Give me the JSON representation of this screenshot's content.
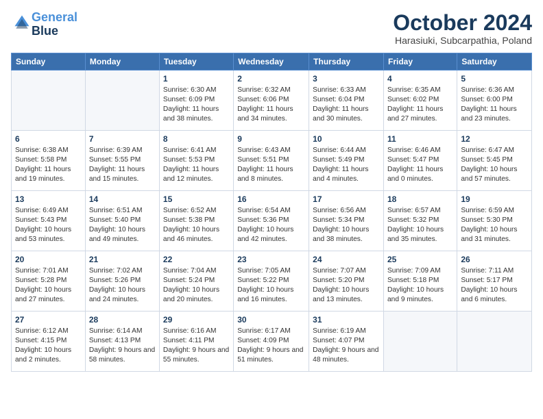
{
  "logo": {
    "line1": "General",
    "line2": "Blue"
  },
  "header": {
    "month": "October 2024",
    "location": "Harasiuki, Subcarpathia, Poland"
  },
  "weekdays": [
    "Sunday",
    "Monday",
    "Tuesday",
    "Wednesday",
    "Thursday",
    "Friday",
    "Saturday"
  ],
  "weeks": [
    [
      {
        "day": "",
        "info": ""
      },
      {
        "day": "",
        "info": ""
      },
      {
        "day": "1",
        "info": "Sunrise: 6:30 AM\nSunset: 6:09 PM\nDaylight: 11 hours and 38 minutes."
      },
      {
        "day": "2",
        "info": "Sunrise: 6:32 AM\nSunset: 6:06 PM\nDaylight: 11 hours and 34 minutes."
      },
      {
        "day": "3",
        "info": "Sunrise: 6:33 AM\nSunset: 6:04 PM\nDaylight: 11 hours and 30 minutes."
      },
      {
        "day": "4",
        "info": "Sunrise: 6:35 AM\nSunset: 6:02 PM\nDaylight: 11 hours and 27 minutes."
      },
      {
        "day": "5",
        "info": "Sunrise: 6:36 AM\nSunset: 6:00 PM\nDaylight: 11 hours and 23 minutes."
      }
    ],
    [
      {
        "day": "6",
        "info": "Sunrise: 6:38 AM\nSunset: 5:58 PM\nDaylight: 11 hours and 19 minutes."
      },
      {
        "day": "7",
        "info": "Sunrise: 6:39 AM\nSunset: 5:55 PM\nDaylight: 11 hours and 15 minutes."
      },
      {
        "day": "8",
        "info": "Sunrise: 6:41 AM\nSunset: 5:53 PM\nDaylight: 11 hours and 12 minutes."
      },
      {
        "day": "9",
        "info": "Sunrise: 6:43 AM\nSunset: 5:51 PM\nDaylight: 11 hours and 8 minutes."
      },
      {
        "day": "10",
        "info": "Sunrise: 6:44 AM\nSunset: 5:49 PM\nDaylight: 11 hours and 4 minutes."
      },
      {
        "day": "11",
        "info": "Sunrise: 6:46 AM\nSunset: 5:47 PM\nDaylight: 11 hours and 0 minutes."
      },
      {
        "day": "12",
        "info": "Sunrise: 6:47 AM\nSunset: 5:45 PM\nDaylight: 10 hours and 57 minutes."
      }
    ],
    [
      {
        "day": "13",
        "info": "Sunrise: 6:49 AM\nSunset: 5:43 PM\nDaylight: 10 hours and 53 minutes."
      },
      {
        "day": "14",
        "info": "Sunrise: 6:51 AM\nSunset: 5:40 PM\nDaylight: 10 hours and 49 minutes."
      },
      {
        "day": "15",
        "info": "Sunrise: 6:52 AM\nSunset: 5:38 PM\nDaylight: 10 hours and 46 minutes."
      },
      {
        "day": "16",
        "info": "Sunrise: 6:54 AM\nSunset: 5:36 PM\nDaylight: 10 hours and 42 minutes."
      },
      {
        "day": "17",
        "info": "Sunrise: 6:56 AM\nSunset: 5:34 PM\nDaylight: 10 hours and 38 minutes."
      },
      {
        "day": "18",
        "info": "Sunrise: 6:57 AM\nSunset: 5:32 PM\nDaylight: 10 hours and 35 minutes."
      },
      {
        "day": "19",
        "info": "Sunrise: 6:59 AM\nSunset: 5:30 PM\nDaylight: 10 hours and 31 minutes."
      }
    ],
    [
      {
        "day": "20",
        "info": "Sunrise: 7:01 AM\nSunset: 5:28 PM\nDaylight: 10 hours and 27 minutes."
      },
      {
        "day": "21",
        "info": "Sunrise: 7:02 AM\nSunset: 5:26 PM\nDaylight: 10 hours and 24 minutes."
      },
      {
        "day": "22",
        "info": "Sunrise: 7:04 AM\nSunset: 5:24 PM\nDaylight: 10 hours and 20 minutes."
      },
      {
        "day": "23",
        "info": "Sunrise: 7:05 AM\nSunset: 5:22 PM\nDaylight: 10 hours and 16 minutes."
      },
      {
        "day": "24",
        "info": "Sunrise: 7:07 AM\nSunset: 5:20 PM\nDaylight: 10 hours and 13 minutes."
      },
      {
        "day": "25",
        "info": "Sunrise: 7:09 AM\nSunset: 5:18 PM\nDaylight: 10 hours and 9 minutes."
      },
      {
        "day": "26",
        "info": "Sunrise: 7:11 AM\nSunset: 5:17 PM\nDaylight: 10 hours and 6 minutes."
      }
    ],
    [
      {
        "day": "27",
        "info": "Sunrise: 6:12 AM\nSunset: 4:15 PM\nDaylight: 10 hours and 2 minutes."
      },
      {
        "day": "28",
        "info": "Sunrise: 6:14 AM\nSunset: 4:13 PM\nDaylight: 9 hours and 58 minutes."
      },
      {
        "day": "29",
        "info": "Sunrise: 6:16 AM\nSunset: 4:11 PM\nDaylight: 9 hours and 55 minutes."
      },
      {
        "day": "30",
        "info": "Sunrise: 6:17 AM\nSunset: 4:09 PM\nDaylight: 9 hours and 51 minutes."
      },
      {
        "day": "31",
        "info": "Sunrise: 6:19 AM\nSunset: 4:07 PM\nDaylight: 9 hours and 48 minutes."
      },
      {
        "day": "",
        "info": ""
      },
      {
        "day": "",
        "info": ""
      }
    ]
  ]
}
